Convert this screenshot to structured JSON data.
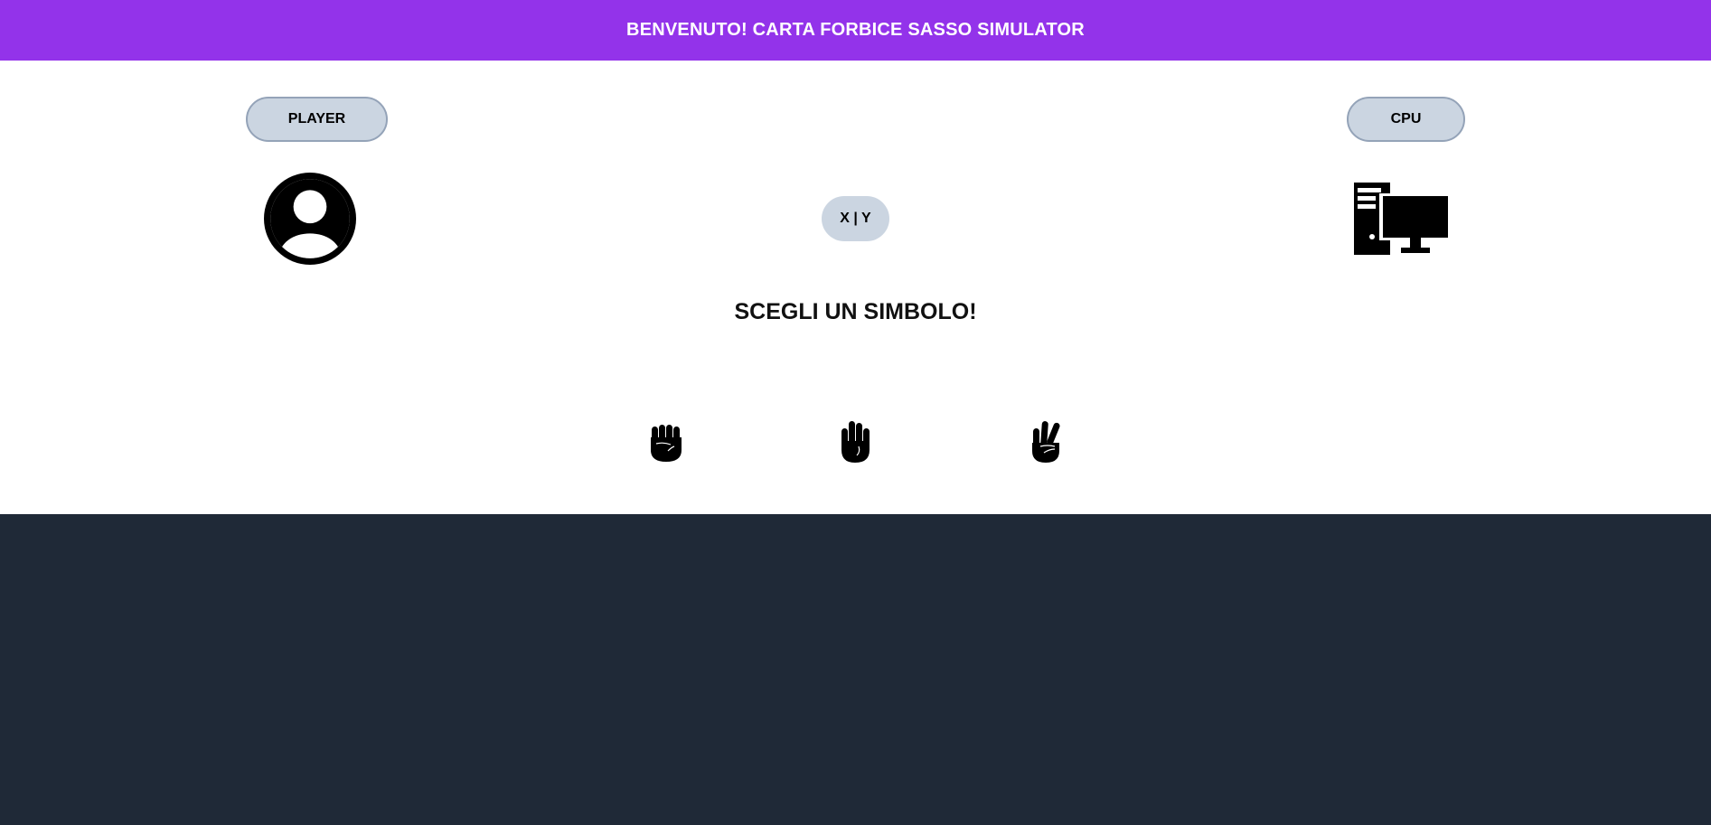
{
  "header": {
    "title": "BENVENUTO! CARTA FORBICE SASSO SIMULATOR"
  },
  "players": {
    "player_label": "PLAYER",
    "cpu_label": "CPU",
    "player_icon": "user-circle-icon",
    "cpu_icon": "desktop-computer-icon"
  },
  "score": {
    "text": "X | Y"
  },
  "prompt": {
    "text": "SCEGLI UN SIMBOLO!"
  },
  "choices": [
    {
      "name": "rock",
      "icon": "fist-icon"
    },
    {
      "name": "paper",
      "icon": "raised-hand-icon"
    },
    {
      "name": "scissors",
      "icon": "victory-hand-icon"
    }
  ],
  "colors": {
    "header_bg": "#9333ea",
    "pill_bg": "#cbd5e1",
    "footer_bg": "#1f2937"
  }
}
